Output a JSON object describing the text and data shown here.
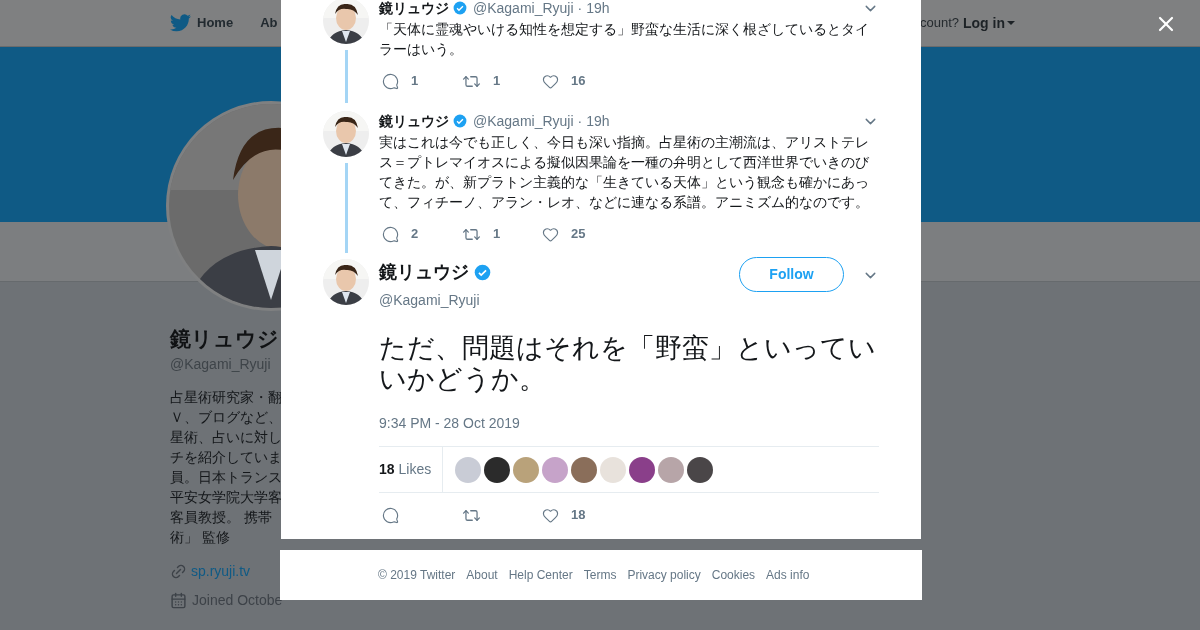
{
  "nav": {
    "items": [
      {
        "label": "Home"
      },
      {
        "label": "Ab"
      }
    ],
    "account_prompt": "count?",
    "login": "Log in"
  },
  "profile": {
    "name": "鏡リュウジ",
    "handle": "@Kagami_Ryuji",
    "bio_lines": [
      "占星術研究家・翻",
      "Ｖ、ブログなど、",
      "星術、占いに対し",
      "チを紹介していま",
      "員。日本トランス",
      "平安女学院大学客",
      "客員教授。 携帯",
      "術」 監修"
    ],
    "link": "sp.ryuji.tv",
    "joined": "Joined Octobe"
  },
  "thread": [
    {
      "name": "鏡リュウジ",
      "handle": "@Kagami_Ryuji",
      "time": "· 19h",
      "text": "「天体に霊魂やいける知性を想定する」野蛮な生活に深く根ざしているとタイラーはいう。",
      "replies": "1",
      "retweets": "1",
      "likes": "16"
    },
    {
      "name": "鏡リュウジ",
      "handle": "@Kagami_Ryuji",
      "time": "· 19h",
      "text": "実はこれは今でも正しく、今日も深い指摘。占星術の主潮流は、アリストテレス＝プトレマイオスによる擬似因果論を一種の弁明として西洋世界でいきのびてきた。が、新プラトン主義的な「生きている天体」という観念も確かにあって、フィチーノ、アラン・レオ、などに連なる系譜。アニミズム的なのです。",
      "replies": "2",
      "retweets": "1",
      "likes": "25"
    }
  ],
  "main_tweet": {
    "name": "鏡リュウジ",
    "handle": "@Kagami_Ryuji",
    "follow": "Follow",
    "text": "ただ、問題はそれを「野蛮」といっていいかどうか。",
    "date": "9:34 PM - 28 Oct 2019",
    "likes_count": "18",
    "likes_label": "Likes",
    "likers": [
      {
        "color": "#c9ccd6"
      },
      {
        "color": "#2b2b2b"
      },
      {
        "color": "#b9a27a"
      },
      {
        "color": "#c6a3c9"
      },
      {
        "color": "#8a6e5a"
      },
      {
        "color": "#e8e2dc"
      },
      {
        "color": "#8a3f8a"
      },
      {
        "color": "#b7a5a8"
      },
      {
        "color": "#4a4648"
      }
    ],
    "likes": "18"
  },
  "footer": [
    "© 2019 Twitter",
    "About",
    "Help Center",
    "Terms",
    "Privacy policy",
    "Cookies",
    "Ads info"
  ]
}
